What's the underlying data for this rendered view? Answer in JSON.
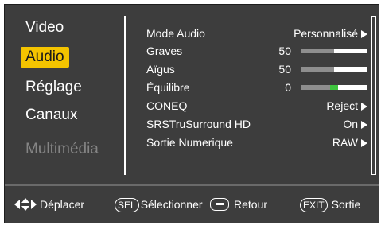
{
  "sidebar": {
    "items": [
      {
        "label": "Video"
      },
      {
        "label": "Audio"
      },
      {
        "label": "Réglage"
      },
      {
        "label": "Canaux"
      },
      {
        "label": "Multimédia"
      }
    ]
  },
  "settings": {
    "mode_audio": {
      "label": "Mode Audio",
      "value": "Personnalisé"
    },
    "graves": {
      "label": "Graves",
      "value": "50",
      "level": 0.5
    },
    "aigus": {
      "label": "Aïgus",
      "value": "50",
      "level": 0.5
    },
    "equilibre": {
      "label": "Équilibre",
      "value": "0",
      "level": 0.5
    },
    "coneq": {
      "label": "CONEQ",
      "value": "Reject"
    },
    "srs": {
      "label": "SRSTruSurround HD",
      "value": "On"
    },
    "sortie": {
      "label": "Sortie Numerique",
      "value": "RAW"
    }
  },
  "footer": {
    "move_label": "Déplacer",
    "sel_key": "SEL",
    "select_label": "Sélectionner",
    "back_label": "Retour",
    "exit_key": "EXIT",
    "exit_label": "Sortie"
  },
  "colors": {
    "background": "#3d3d3d",
    "highlight": "#f4c400",
    "balance_marker": "#3ec43e"
  }
}
